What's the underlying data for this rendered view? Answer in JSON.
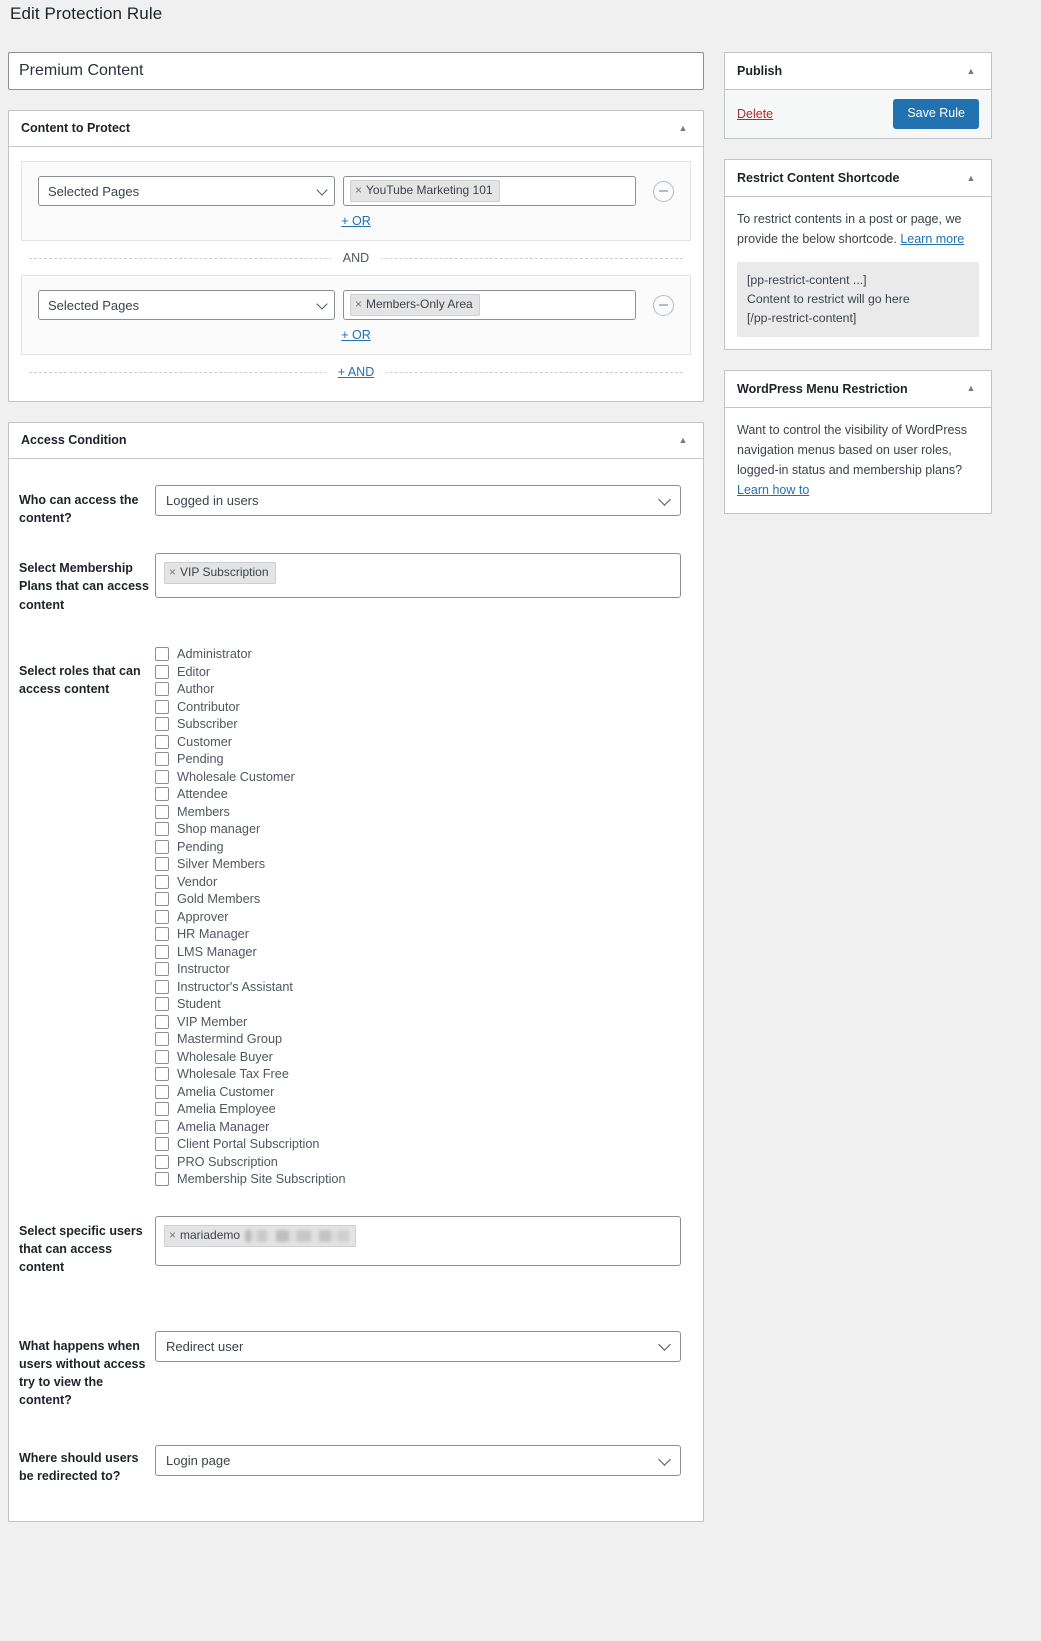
{
  "page": {
    "title": "Edit Protection Rule",
    "rule_title_value": "Premium Content",
    "rule_title_placeholder": "Enter rule title here"
  },
  "content_to_protect": {
    "panel_title": "Content to Protect",
    "toggle_icon": "chevron-up-icon",
    "and_divider_label": "AND",
    "add_and_label": "+ AND",
    "groups": [
      {
        "select_value": "Selected Pages",
        "tokens": [
          "YouTube Marketing 101"
        ],
        "add_or_label": "+ OR",
        "remove_icon": "minus-circle-icon"
      },
      {
        "select_value": "Selected Pages",
        "tokens": [
          "Members-Only Area"
        ],
        "add_or_label": "+ OR",
        "remove_icon": "minus-circle-icon"
      }
    ]
  },
  "access_condition": {
    "panel_title": "Access Condition",
    "toggle_icon": "chevron-up-icon",
    "who_can_access": {
      "label": "Who can access the content?",
      "value": "Logged in users"
    },
    "membership_plans": {
      "label": "Select Membership Plans that can access content",
      "tokens": [
        "VIP Subscription"
      ]
    },
    "roles": {
      "label": "Select roles that can access content",
      "items": [
        {
          "label": "Administrator",
          "checked": false
        },
        {
          "label": "Editor",
          "checked": false
        },
        {
          "label": "Author",
          "checked": false
        },
        {
          "label": "Contributor",
          "checked": false
        },
        {
          "label": "Subscriber",
          "checked": false
        },
        {
          "label": "Customer",
          "checked": false
        },
        {
          "label": "Pending",
          "checked": false
        },
        {
          "label": "Wholesale Customer",
          "checked": false
        },
        {
          "label": "Attendee",
          "checked": false
        },
        {
          "label": "Members",
          "checked": false
        },
        {
          "label": "Shop manager",
          "checked": false
        },
        {
          "label": "Pending",
          "checked": false
        },
        {
          "label": "Silver Members",
          "checked": false
        },
        {
          "label": "Vendor",
          "checked": false
        },
        {
          "label": "Gold Members",
          "checked": false
        },
        {
          "label": "Approver",
          "checked": false
        },
        {
          "label": "HR Manager",
          "checked": false
        },
        {
          "label": "LMS Manager",
          "checked": false
        },
        {
          "label": "Instructor",
          "checked": false
        },
        {
          "label": "Instructor's Assistant",
          "checked": false
        },
        {
          "label": "Student",
          "checked": false
        },
        {
          "label": "VIP Member",
          "checked": false
        },
        {
          "label": "Mastermind Group",
          "checked": false
        },
        {
          "label": "Wholesale Buyer",
          "checked": false
        },
        {
          "label": "Wholesale Tax Free",
          "checked": false
        },
        {
          "label": "Amelia Customer",
          "checked": false
        },
        {
          "label": "Amelia Employee",
          "checked": false
        },
        {
          "label": "Amelia Manager",
          "checked": false
        },
        {
          "label": "Client Portal Subscription",
          "checked": false
        },
        {
          "label": "PRO Subscription",
          "checked": false
        },
        {
          "label": "Membership Site Subscription",
          "checked": false
        }
      ]
    },
    "specific_users": {
      "label": "Select specific users that can access content",
      "tokens": [
        "mariademo"
      ],
      "token_redacted_suffix": true
    },
    "no_access_action": {
      "label": "What happens when users without access try to view the content?",
      "value": "Redirect user"
    },
    "redirect_target": {
      "label": "Where should users be redirected to?",
      "value": "Login page"
    }
  },
  "sidebar": {
    "publish": {
      "title": "Publish",
      "toggle_icon": "chevron-up-icon",
      "delete_label": "Delete",
      "save_label": "Save Rule"
    },
    "shortcode": {
      "title": "Restrict Content Shortcode",
      "toggle_icon": "chevron-up-icon",
      "description": "To restrict contents in a post or page, we provide the below shortcode.",
      "learn_more_label": "Learn more",
      "code_lines": [
        "[pp-restrict-content ...]",
        "Content to restrict will go here",
        "[/pp-restrict-content]"
      ]
    },
    "menu_restriction": {
      "title": "WordPress Menu Restriction",
      "toggle_icon": "chevron-up-icon",
      "description": "Want to control the visibility of WordPress navigation menus based on user roles, logged-in status and membership plans?",
      "learn_how_label": "Learn how to"
    }
  },
  "colors": {
    "primary": "#2271b1",
    "danger": "#b32d2e",
    "page_bg": "#f0f0f1",
    "border": "#c3c4c7"
  }
}
